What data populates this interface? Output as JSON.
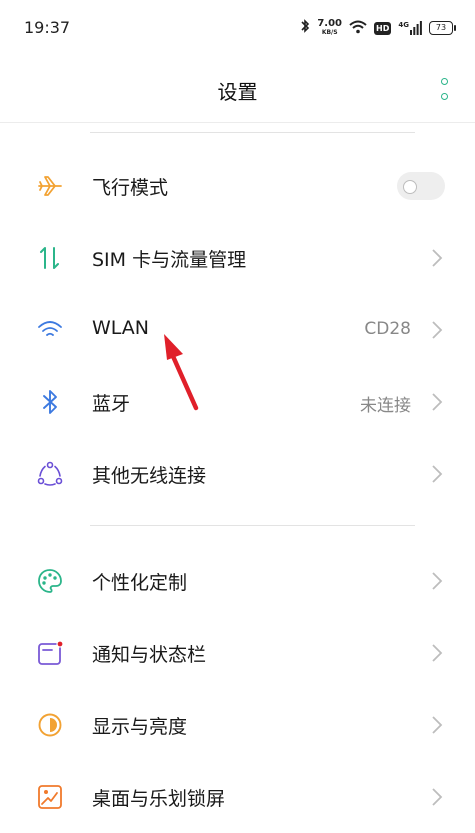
{
  "status_bar": {
    "time": "19:37",
    "speed_value": "7.00",
    "speed_unit": "KB/S",
    "hd_badge": "HD",
    "network": "4G",
    "battery": "73"
  },
  "header": {
    "title": "设置"
  },
  "settings": {
    "airplane": {
      "label": "飞行模式",
      "enabled": false
    },
    "sim": {
      "label": "SIM 卡与流量管理"
    },
    "wlan": {
      "label": "WLAN",
      "value": "CD28"
    },
    "bluetooth": {
      "label": "蓝牙",
      "value": "未连接"
    },
    "wireless_other": {
      "label": "其他无线连接"
    },
    "personalize": {
      "label": "个性化定制"
    },
    "notifications": {
      "label": "通知与状态栏"
    },
    "display": {
      "label": "显示与亮度"
    },
    "desktop": {
      "label": "桌面与乐划锁屏"
    }
  },
  "colors": {
    "accent": "#2bb58a",
    "annotation_arrow": "#e0202a",
    "airplane_icon": "#f2a233",
    "sim_icon": "#2bb58a",
    "wlan_icon": "#3d7ae0",
    "bluetooth_icon": "#3d7ae0",
    "wireless_icon": "#6a4fd6",
    "personalize_icon": "#2bb58a",
    "notifications_icon": "#7a5ad6",
    "display_icon": "#f2a233",
    "desktop_icon": "#f07a2c"
  }
}
